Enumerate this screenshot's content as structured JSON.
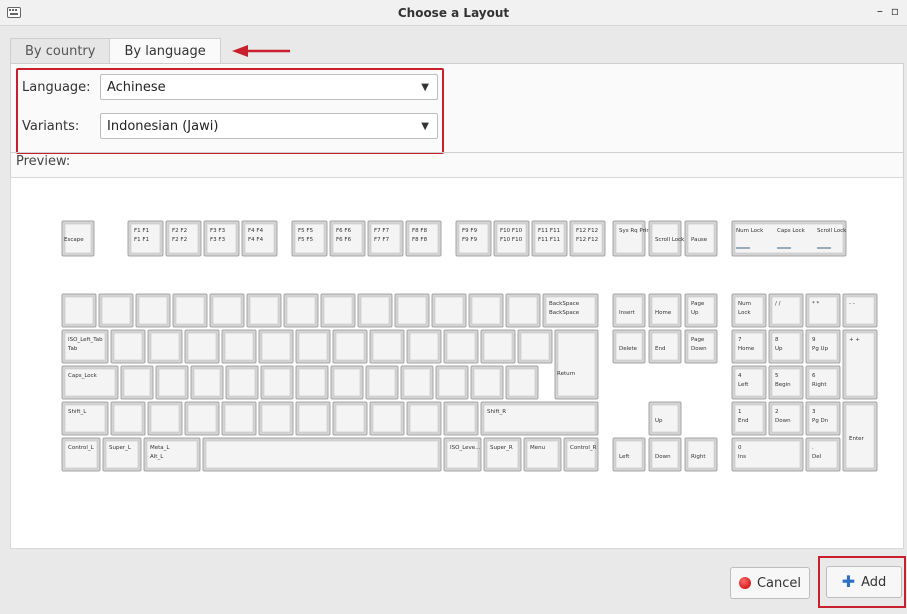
{
  "window": {
    "title": "Choose a Layout",
    "minimize_glyph": "–",
    "maximize_glyph": "▫"
  },
  "tabs": [
    {
      "label": "By country",
      "active": false
    },
    {
      "label": "By language",
      "active": true
    }
  ],
  "language": {
    "label": "Language:",
    "value": "Achinese"
  },
  "variants": {
    "label": "Variants:",
    "value": "Indonesian (Jawi)"
  },
  "preview": {
    "label": "Preview:"
  },
  "buttons": {
    "cancel": "Cancel",
    "add": "Add"
  },
  "colors": {
    "highlight": "#c8202c",
    "key_fill": "#d4d4d4",
    "key_border": "#a4a4a4",
    "add_icon": "#2f6fc4"
  },
  "keyboard": {
    "function_row": [
      "Escape",
      "F1",
      "F2",
      "F3",
      "F4",
      "F5",
      "F6",
      "F7",
      "F8",
      "F9",
      "F10",
      "F11",
      "F12",
      "Sys Rq Print",
      "Scroll Lock",
      "Pause",
      "Num Lock",
      "Caps Lock",
      "Scroll Lock"
    ],
    "main_labels": [
      "BackSpace",
      "ISO_Left_Tab",
      "Tab",
      "Caps_Lock",
      "Return",
      "Shift_L",
      "Shift_R",
      "Control_L",
      "Super_L",
      "Meta_L Alt_L",
      "ISO_Leve...",
      "Super_R",
      "Menu",
      "Control_R"
    ],
    "nav_labels": [
      "Insert",
      "Home",
      "Page Up",
      "Delete",
      "End",
      "Page Down",
      "Up",
      "Left",
      "Down",
      "Right"
    ],
    "numpad_labels": [
      "Num Lock",
      "7 Home",
      "8 Up",
      "9 Pg Up",
      "4 Left",
      "5 Begin",
      "6 Right",
      "1 End",
      "2 Down",
      "3 Pg Dn",
      "0 Ins",
      ". Del",
      "Enter"
    ]
  }
}
